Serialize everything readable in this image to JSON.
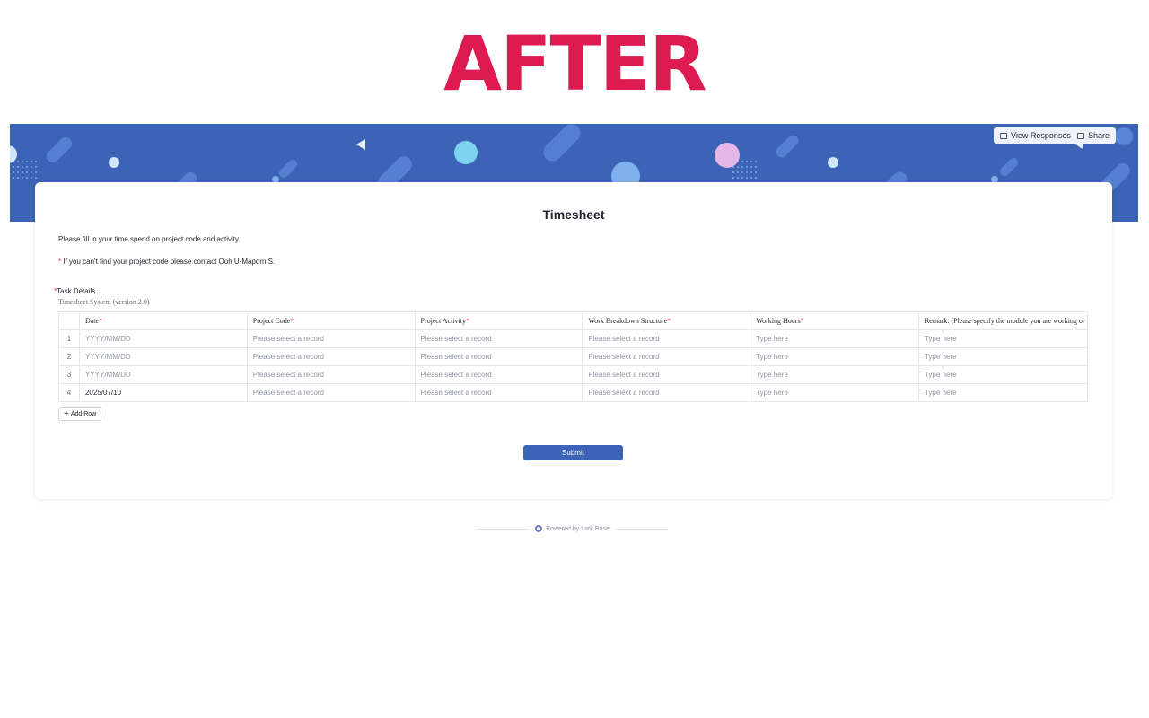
{
  "headline": "AFTER",
  "toolbar": {
    "view_responses": "View Responses",
    "share": "Share"
  },
  "form": {
    "title": "Timesheet",
    "description_line1": "Please fill in your time spend on project code and activity",
    "description_line2_star": "*",
    "description_line2": " If you can't find your project code please contact Ooh U-Maporn S.",
    "field_required_star": "*",
    "field_label": "Task Details",
    "field_sublabel": "Timesheet System (version 2.0)",
    "columns": [
      {
        "label": "Date",
        "required": "*"
      },
      {
        "label": "Project Code",
        "required": "*"
      },
      {
        "label": "Project Activity",
        "required": "*"
      },
      {
        "label": "Work Breakdown Structure",
        "required": "*"
      },
      {
        "label": "Working Hours",
        "required": "*"
      },
      {
        "label": "Remark: (Please specify the module you are working or",
        "required": ""
      }
    ],
    "rows": [
      {
        "index": "1",
        "date": "YYYY/MM/DD",
        "project_code": "Please select a record",
        "project_activity": "Please select a record",
        "wbs": "Please select a record",
        "working_hours": "Type here",
        "remark": "Type here"
      },
      {
        "index": "2",
        "date": "YYYY/MM/DD",
        "project_code": "Please select a record",
        "project_activity": "Please select a record",
        "wbs": "Please select a record",
        "working_hours": "Type here",
        "remark": "Type here"
      },
      {
        "index": "3",
        "date": "YYYY/MM/DD",
        "project_code": "Please select a record",
        "project_activity": "Please select a record",
        "wbs": "Please select a record",
        "working_hours": "Type here",
        "remark": "Type here"
      },
      {
        "index": "4",
        "date": "2025/07/10",
        "project_code": "Please select a record",
        "project_activity": "Please select a record",
        "wbs": "Please select a record",
        "working_hours": "Type here",
        "remark": "Type here"
      }
    ],
    "add_row": "Add Row",
    "submit": "Submit"
  },
  "footer": {
    "powered_by": "Powered by Lark Base"
  },
  "colors": {
    "headline": "#dd1b50",
    "banner": "#3c63b5",
    "accent": "#3c63b5",
    "required": "#e6323e"
  }
}
